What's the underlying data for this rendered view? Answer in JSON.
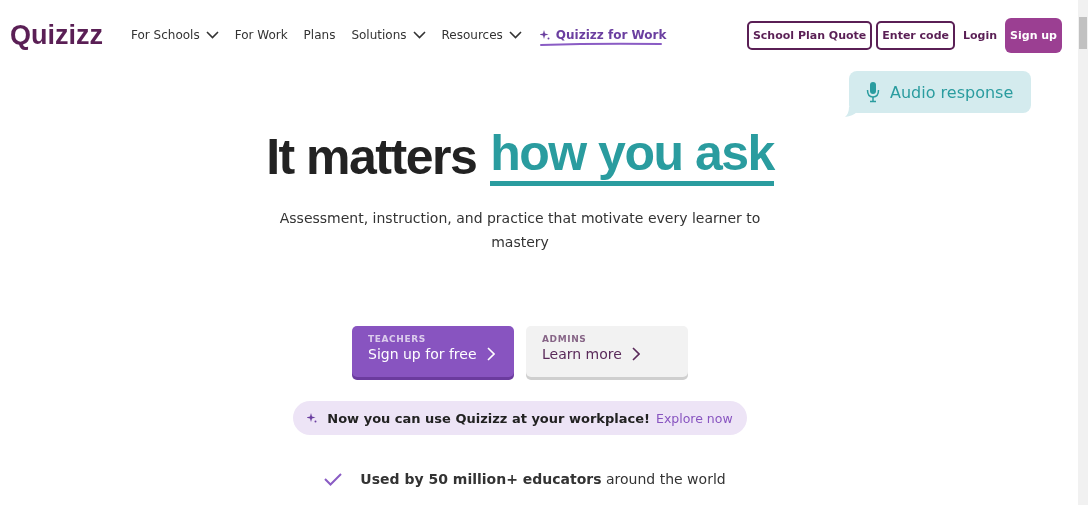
{
  "logo": "Quizizz",
  "nav": [
    {
      "label": "For Schools",
      "kind": "menu"
    },
    {
      "label": "For Work",
      "kind": "link"
    },
    {
      "label": "Plans",
      "kind": "link"
    },
    {
      "label": "Solutions",
      "kind": "menu"
    },
    {
      "label": "Resources",
      "kind": "menu"
    },
    {
      "label": "Quizizz for Work",
      "kind": "featured"
    }
  ],
  "actions": [
    {
      "label": "School Plan Quote",
      "kind": "outline"
    },
    {
      "label": "Enter code",
      "kind": "outline"
    },
    {
      "label": "Login",
      "kind": "text"
    },
    {
      "label": "Sign up",
      "kind": "filled"
    }
  ],
  "bubble": "Audio response",
  "headline": {
    "lead": "It matters",
    "accent": "how you ask"
  },
  "subtitle": "Assessment, instruction, and practice that motivate every learner to mastery",
  "cta": [
    {
      "eyebrow": "TEACHERS",
      "label": "Sign up for free",
      "kind": "primary"
    },
    {
      "eyebrow": "ADMINS",
      "label": "Learn more",
      "kind": "secondary"
    }
  ],
  "banner": {
    "text": "Now you can use Quizizz at your workplace!",
    "link": "Explore now"
  },
  "highlights": [
    "**Used by 50 million+ educators** around the world"
  ]
}
